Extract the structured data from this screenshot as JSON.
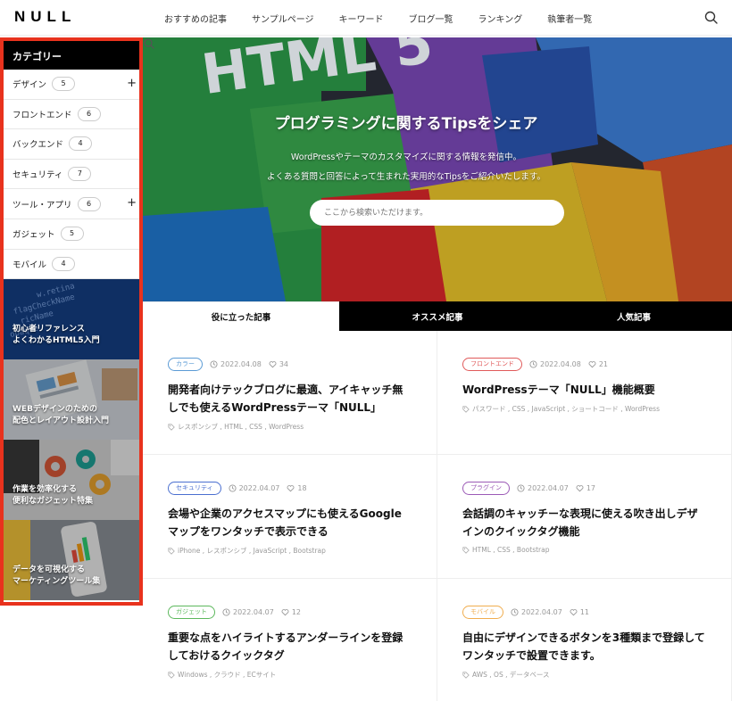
{
  "header": {
    "logo": "NULL",
    "nav": [
      "おすすめの記事",
      "サンプルページ",
      "キーワード",
      "ブログ一覧",
      "ランキング",
      "執筆者一覧"
    ],
    "search_icon": "search-icon"
  },
  "sidebar": {
    "heading": "カテゴリー",
    "categories": [
      {
        "label": "デザイン",
        "count": "5",
        "expandable": true
      },
      {
        "label": "フロントエンド",
        "count": "6",
        "expandable": false
      },
      {
        "label": "バックエンド",
        "count": "4",
        "expandable": false
      },
      {
        "label": "セキュリティ",
        "count": "7",
        "expandable": false
      },
      {
        "label": "ツール・アプリ",
        "count": "6",
        "expandable": true
      },
      {
        "label": "ガジェット",
        "count": "5",
        "expandable": false
      },
      {
        "label": "モバイル",
        "count": "4",
        "expandable": false
      }
    ],
    "expand_symbol": "+",
    "banners": [
      {
        "label": "初心者リファレンス\nよくわかるHTML5入門"
      },
      {
        "label": "WEBデザインのための\n配色とレイアウト設計入門"
      },
      {
        "label": "作業を効率化する\n便利なガジェット特集"
      },
      {
        "label": "データを可視化する\nマーケティングツール集"
      }
    ],
    "highlight_color": "#e8321d"
  },
  "hero": {
    "title": "プログラミングに関するTipsをシェア",
    "subtitle1": "WordPressやテーマのカスタマイズに関する情報を発信中。",
    "subtitle2": "よくある質問と回答によって生まれた実用的なTipsをご紹介いたします。",
    "search_placeholder": "ここから検索いただけます。",
    "bg_text": "HTML 5"
  },
  "tabs": [
    {
      "label": "役に立った記事",
      "active": true
    },
    {
      "label": "オススメ記事",
      "active": false
    },
    {
      "label": "人気記事",
      "active": false
    }
  ],
  "articles": [
    {
      "category": "カラー",
      "badge_color": "#5b9bd5",
      "date": "2022.04.08",
      "likes": "34",
      "title": "開発者向けテックブログに最適、アイキャッチ無しでも使えるWordPressテーマ「NULL」",
      "tags": "レスポンシブ , HTML , CSS , WordPress"
    },
    {
      "category": "フロントエンド",
      "badge_color": "#e05a5a",
      "date": "2022.04.08",
      "likes": "21",
      "title": "WordPressテーマ「NULL」機能概要",
      "tags": "パスワード , CSS , JavaScript , ショートコード , WordPress"
    },
    {
      "category": "セキュリティ",
      "badge_color": "#4a6fd0",
      "date": "2022.04.07",
      "likes": "18",
      "title": "会場や企業のアクセスマップにも使えるGoogleマップをワンタッチで表示できる",
      "tags": "iPhone , レスポンシブ , JavaScript , Bootstrap"
    },
    {
      "category": "プラグイン",
      "badge_color": "#9b59b6",
      "date": "2022.04.07",
      "likes": "17",
      "title": "会話調のキャッチーな表現に使える吹き出しデザインのクイックタグ機能",
      "tags": "HTML , CSS , Bootstrap"
    },
    {
      "category": "ガジェット",
      "badge_color": "#5cb85c",
      "date": "2022.04.07",
      "likes": "12",
      "title": "重要な点をハイライトするアンダーラインを登録しておけるクイックタグ",
      "tags": "Windows , クラウド , ECサイト"
    },
    {
      "category": "モバイル",
      "badge_color": "#f0ad4e",
      "date": "2022.04.07",
      "likes": "11",
      "title": "自由にデザインできるボタンを3種類まで登録してワンタッチで設置できます。",
      "tags": "AWS , OS , データベース"
    }
  ]
}
